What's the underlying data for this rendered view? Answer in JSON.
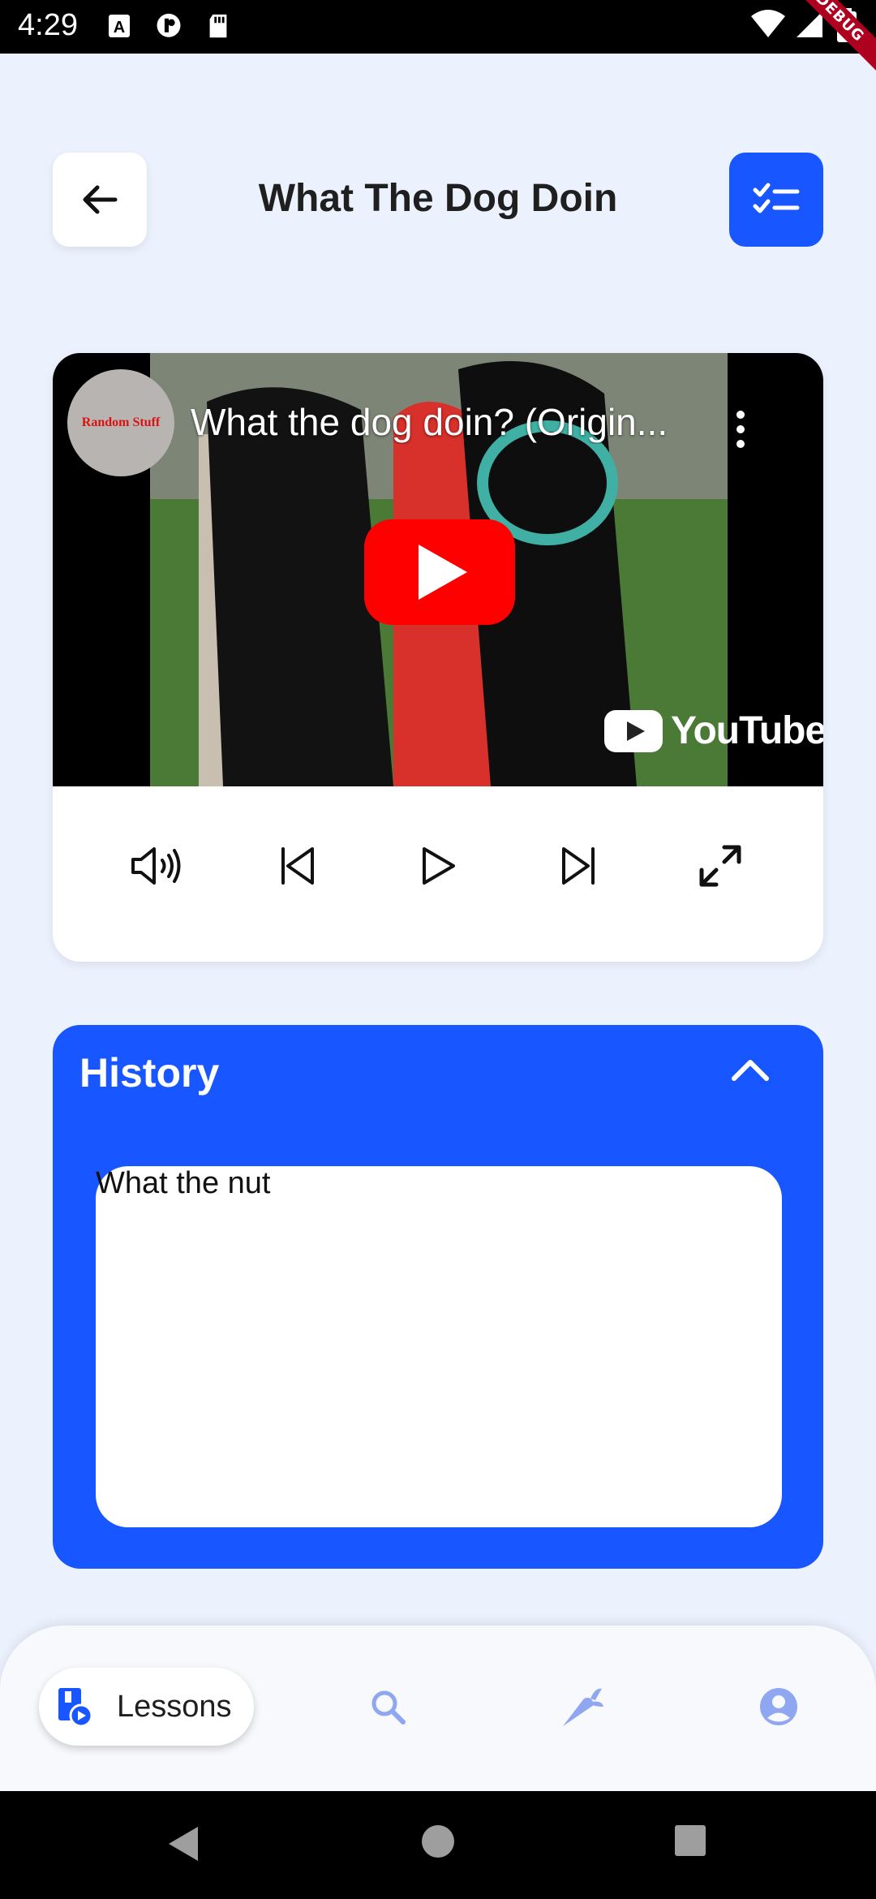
{
  "status_bar": {
    "time": "4:29",
    "debug_label": "DEBUG"
  },
  "header": {
    "title": "What The Dog Doin"
  },
  "video": {
    "channel_avatar_text": "Random Stuff",
    "title": "What the dog doin? (Origin...",
    "youtube_logo_text": "YouTube"
  },
  "history": {
    "title": "History",
    "notes_value": "What the nut"
  },
  "bottom_nav": {
    "lessons_label": "Lessons"
  },
  "colors": {
    "accent": "#1856FF",
    "background": "#EBF1FD",
    "nav_inactive": "#8FA6F0"
  }
}
